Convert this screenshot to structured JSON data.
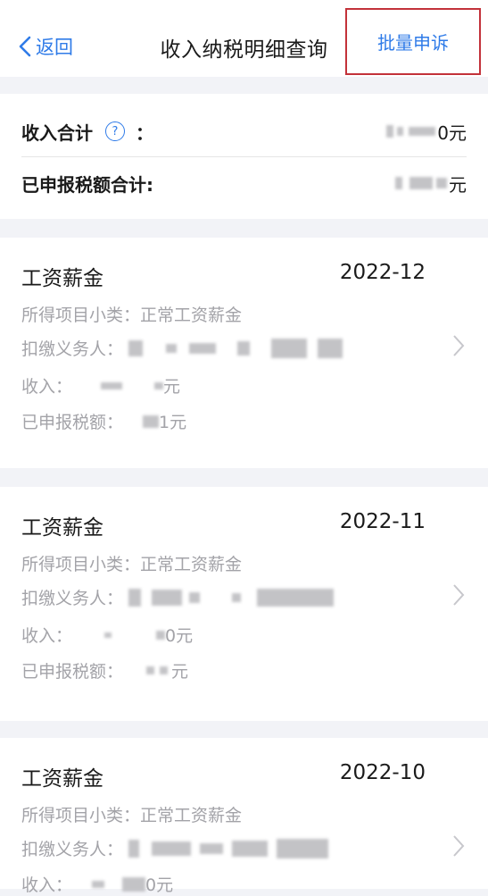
{
  "nav": {
    "back_label": "返回",
    "title": "收入纳税明细查询",
    "batch_appeal": "批量申诉"
  },
  "summary": {
    "income_total_label": "收入合计",
    "help_symbol": "?",
    "colon": "：",
    "income_total_suffix": "0元",
    "tax_total_label": "已申报税额合计:",
    "tax_total_suffix": "元"
  },
  "records": [
    {
      "category": "工资薪金",
      "period": "2022-12",
      "item_label": "所得项目小类：",
      "item_value": "正常工资薪金",
      "withholder_label": "扣缴义务人：",
      "income_label": "收入：",
      "income_suffix": "元",
      "tax_label": "已申报税额：",
      "tax_suffix": "1元"
    },
    {
      "category": "工资薪金",
      "period": "2022-11",
      "item_label": "所得项目小类：",
      "item_value": "正常工资薪金",
      "withholder_label": "扣缴义务人：",
      "income_label": "收入：",
      "income_suffix": "0元",
      "tax_label": "已申报税额：",
      "tax_suffix": "元"
    },
    {
      "category": "工资薪金",
      "period": "2022-10",
      "item_label": "所得项目小类：",
      "item_value": "正常工资薪金",
      "withholder_label": "扣缴义务人：",
      "income_label": "收入：",
      "income_suffix": "0元"
    }
  ],
  "colors": {
    "accent": "#2f7be8",
    "highlight_border": "#c3323a",
    "page_bg": "#f2f3f7",
    "muted_text": "#a3a3a8"
  },
  "icons": {
    "back": "chevron-left-icon",
    "help": "question-circle-icon",
    "row_arrow": "chevron-right-icon"
  }
}
